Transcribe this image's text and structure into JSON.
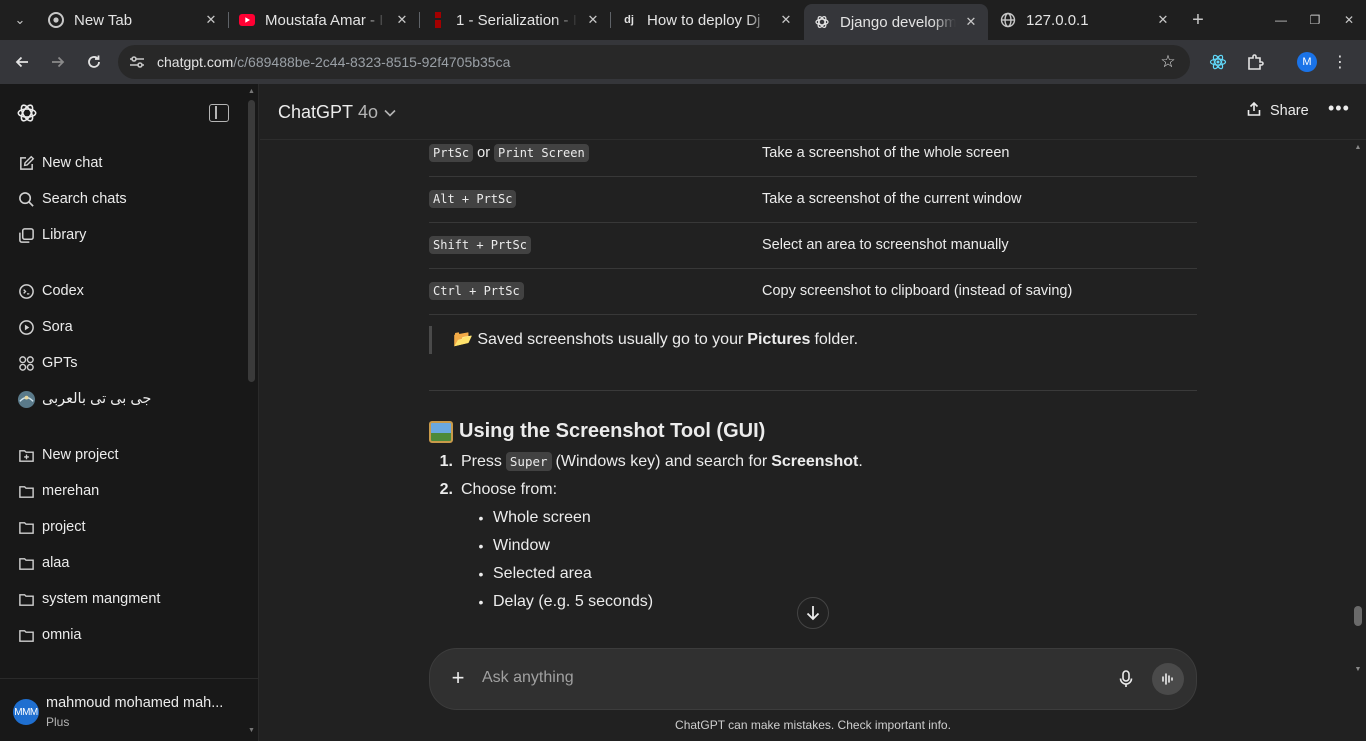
{
  "browser": {
    "tabs": [
      {
        "title": "New Tab",
        "favicon": "chrome-icon"
      },
      {
        "title": "Moustafa Amar - I",
        "favicon": "youtube-icon"
      },
      {
        "title": "1 - Serialization - I",
        "favicon": "drf-icon"
      },
      {
        "title": "How to deploy Dj",
        "favicon": "django-icon"
      },
      {
        "title": "Django developm",
        "favicon": "chatgpt-icon"
      },
      {
        "title": "127.0.0.1",
        "favicon": "globe-icon"
      }
    ],
    "url_host": "chatgpt.com",
    "url_path": "/c/689488be-2c44-8323-8515-92f4705b35ca",
    "profile_initial": "M"
  },
  "sidebar": {
    "primary": [
      {
        "label": "New chat",
        "icon": "edit-icon"
      },
      {
        "label": "Search chats",
        "icon": "search-icon"
      },
      {
        "label": "Library",
        "icon": "library-icon"
      }
    ],
    "tools": [
      {
        "label": "Codex",
        "icon": "codex-icon"
      },
      {
        "label": "Sora",
        "icon": "sora-icon"
      },
      {
        "label": "GPTs",
        "icon": "gpts-icon"
      },
      {
        "label": "جى بى تى بالعربى",
        "icon": "custom-gpt-avatar"
      }
    ],
    "projects": [
      {
        "label": "New project",
        "icon": "new-folder-icon"
      },
      {
        "label": "merehan",
        "icon": "folder-icon"
      },
      {
        "label": "project",
        "icon": "folder-icon"
      },
      {
        "label": "alaa",
        "icon": "folder-icon"
      },
      {
        "label": "system mangment",
        "icon": "folder-icon"
      },
      {
        "label": "omnia",
        "icon": "folder-icon"
      }
    ],
    "user": {
      "initials": "MMM",
      "name": "mahmoud mohamed mah...",
      "plan": "Plus"
    }
  },
  "header": {
    "model": "ChatGPT",
    "version": "4o",
    "share_label": "Share"
  },
  "message": {
    "shortcuts": [
      {
        "keys": [
          "PrtSc",
          "Print Screen"
        ],
        "joiner": "or",
        "desc": "Take a screenshot of the whole screen"
      },
      {
        "keys": [
          "Alt + PrtSc"
        ],
        "desc": "Take a screenshot of the current window"
      },
      {
        "keys": [
          "Shift + PrtSc"
        ],
        "desc": "Select an area to screenshot manually"
      },
      {
        "keys": [
          "Ctrl + PrtSc"
        ],
        "desc": "Copy screenshot to clipboard (instead of saving)"
      }
    ],
    "quote_prefix": "📂 Saved screenshots usually go to your",
    "quote_bold": "Pictures",
    "quote_suffix": "folder.",
    "section_title": "Using the Screenshot Tool (GUI)",
    "steps": {
      "s1_num": "1.",
      "s1_pre": "Press",
      "s1_key": "Super",
      "s1_mid": "(Windows key) and search for",
      "s1_bold": "Screenshot",
      "s1_end": ".",
      "s2_num": "2.",
      "s2_text": "Choose from:"
    },
    "options": [
      "Whole screen",
      "Window",
      "Selected area",
      "Delay (e.g. 5 seconds)"
    ]
  },
  "composer": {
    "placeholder": "Ask anything"
  },
  "disclaimer": "ChatGPT can make mistakes. Check important info."
}
